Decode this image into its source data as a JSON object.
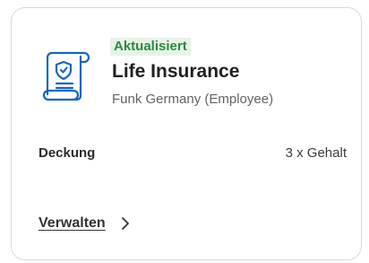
{
  "card": {
    "badge": "Aktualisiert",
    "title": "Life Insurance",
    "subtitle": "Funk Germany (Employee)",
    "coverage_label": "Deckung",
    "coverage_value": "3 x Gehalt",
    "manage_label": "Verwalten",
    "icon": "policy-document-shield-icon",
    "accent_color": "#1565c0",
    "badge_color": "#2b8a3e"
  }
}
